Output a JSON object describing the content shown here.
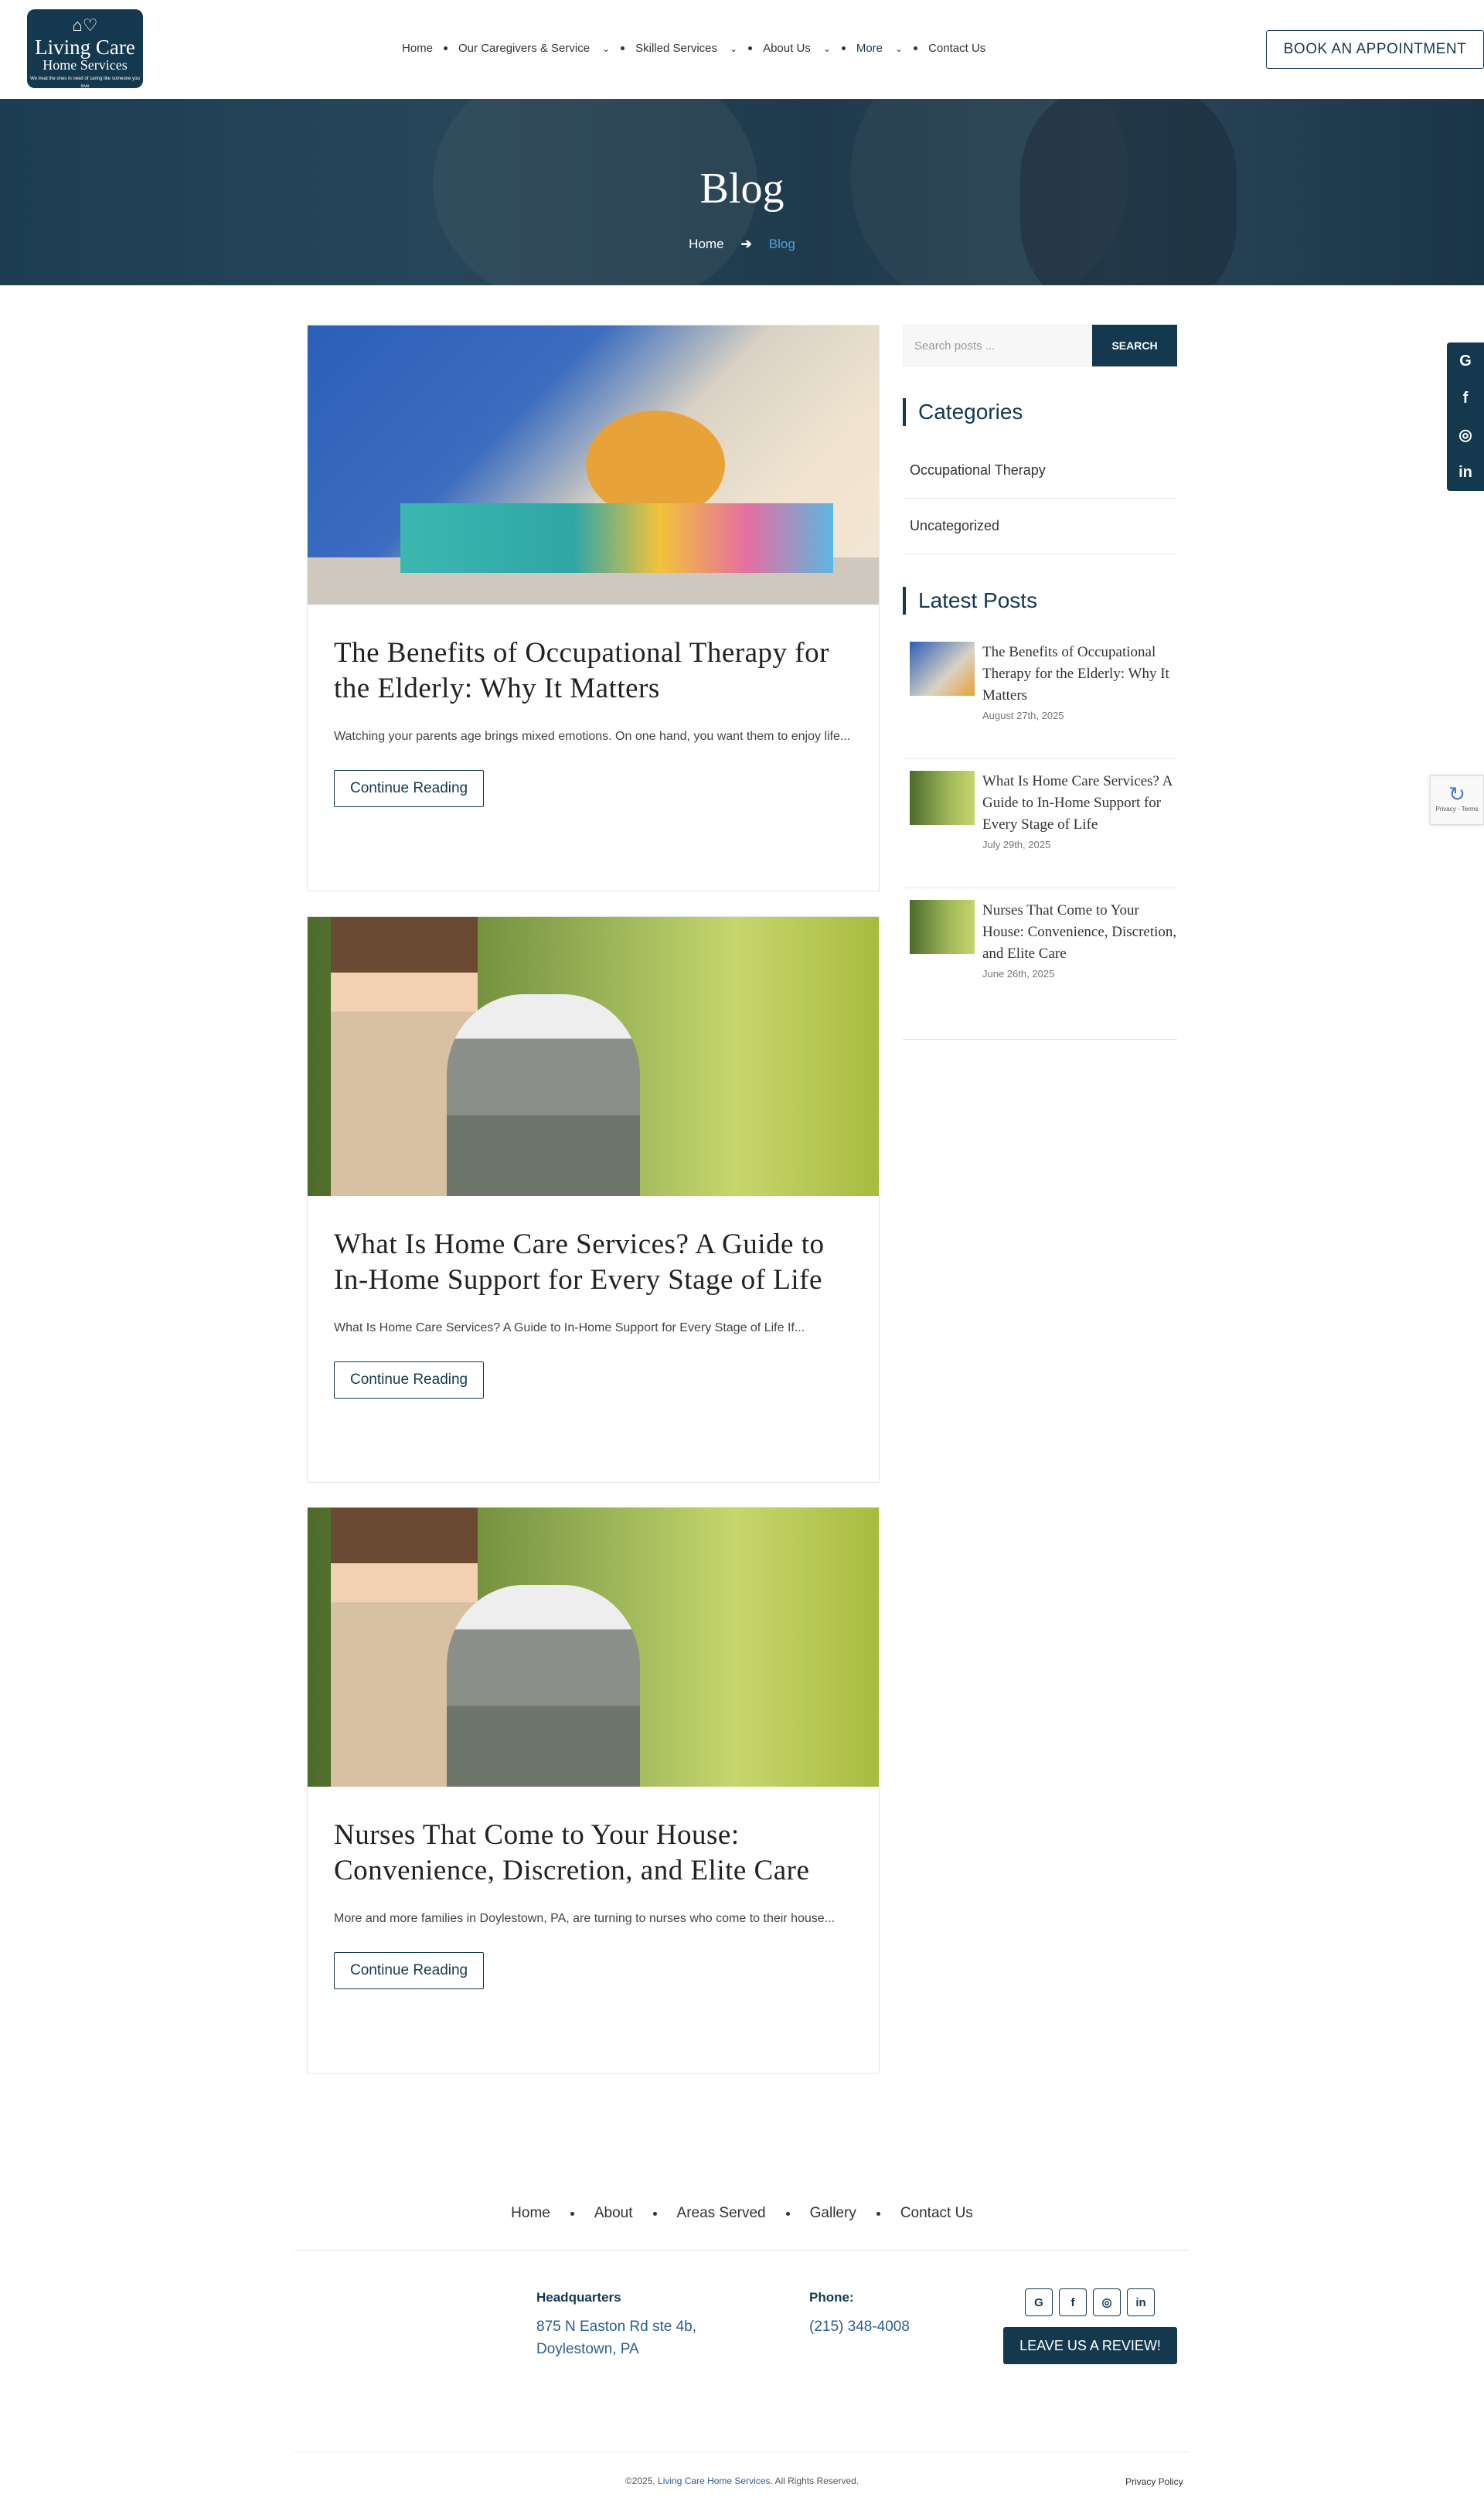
{
  "header": {
    "logo": {
      "line1": "Living Care",
      "line2": "Home Services",
      "tagline": "We treat the ones in need of caring like someone you love"
    },
    "nav": [
      {
        "label": "Home",
        "dropdown": false
      },
      {
        "label": "Our Caregivers & Service",
        "dropdown": true
      },
      {
        "label": "Skilled Services",
        "dropdown": true
      },
      {
        "label": "About Us",
        "dropdown": true
      },
      {
        "label": "More",
        "dropdown": true
      },
      {
        "label": "Contact Us",
        "dropdown": false
      }
    ],
    "book_label": "BOOK AN APPOINTMENT"
  },
  "hero": {
    "title": "Blog",
    "breadcrumb": {
      "home": "Home",
      "current": "Blog"
    }
  },
  "posts": [
    {
      "title": "The Benefits of Occupational Therapy for the Elderly: Why It Matters",
      "excerpt": "Watching your parents age brings mixed emotions. On one hand, you want them to enjoy life...",
      "button": "Continue Reading"
    },
    {
      "title": "What Is Home Care Services? A Guide to In-Home Support for Every Stage of Life",
      "excerpt": "What Is Home Care Services? A Guide to In-Home Support for Every Stage of Life If...",
      "button": "Continue Reading"
    },
    {
      "title": "Nurses That Come to Your House: Convenience, Discretion, and Elite Care",
      "excerpt": "More and more families in Doylestown, PA, are turning to nurses who come to their house...",
      "button": "Continue Reading"
    }
  ],
  "sidebar": {
    "search_placeholder": "Search posts ...",
    "search_button": "SEARCH",
    "categories_title": "Categories",
    "categories": [
      "Occupational Therapy",
      "Uncategorized"
    ],
    "latest_title": "Latest Posts",
    "latest": [
      {
        "title": "The Benefits of Occupational Therapy for the Elderly: Why It Matters",
        "date": "August 27th, 2025"
      },
      {
        "title": "What Is Home Care Services? A Guide to In-Home Support for Every Stage of Life",
        "date": "July 29th, 2025"
      },
      {
        "title": "Nurses That Come to Your House: Convenience, Discretion, and Elite Care",
        "date": "June 26th, 2025"
      }
    ]
  },
  "social": [
    "G",
    "f",
    "◎",
    "in"
  ],
  "recaptcha": "Privacy - Terms",
  "footer": {
    "nav": [
      "Home",
      "About",
      "Areas Served",
      "Gallery",
      "Contact Us"
    ],
    "hq_label": "Headquarters",
    "hq_line1": "875 N Easton Rd ste 4b,",
    "hq_line2": "Doylestown, PA",
    "phone_label": "Phone:",
    "phone": "(215) 348-4008",
    "review_label": "LEAVE US A REVIEW!",
    "copyright_pre": "©2025, ",
    "copyright_name": "Living Care Home Services",
    "copyright_post": ". All Rights Reserved.",
    "privacy": "Privacy Policy"
  }
}
